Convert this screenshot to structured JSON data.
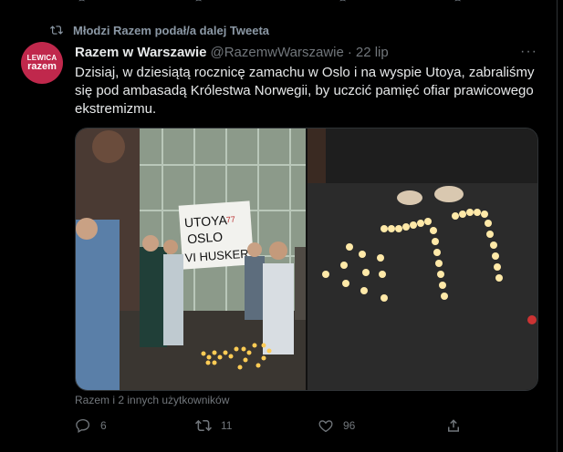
{
  "retweet_context": {
    "text": "Młodzi Razem podał/a dalej Tweeta"
  },
  "author": {
    "display_name": "Razem w Warszawie",
    "handle": "@RazemwWarszawie",
    "separator": "·",
    "date": "22 lip",
    "avatar_line1": "LEWICA",
    "avatar_line2": "razem"
  },
  "tweet": {
    "text": "Dzisiaj, w dziesiątą rocznicę zamachu w Oslo i na wyspie Utoya, zabraliśmy się pod ambasadą Królestwa Norwegii, by uczcić pamięć ofiar prawicowego ekstremizmu."
  },
  "media": {
    "banner_line1": "UTOYA",
    "banner_line2": "OSLO",
    "banner_line3": "VI HUSKER",
    "banner_number": "77",
    "candle_number": "77"
  },
  "caption": "Razem i 2 innych użytkowników",
  "actions": {
    "reply_count": "6",
    "retweet_count": "11",
    "like_count": "96"
  },
  "colors": {
    "background": "#000000",
    "text": "#e7e9ea",
    "muted": "#71767b",
    "avatar": "#c0284c"
  }
}
